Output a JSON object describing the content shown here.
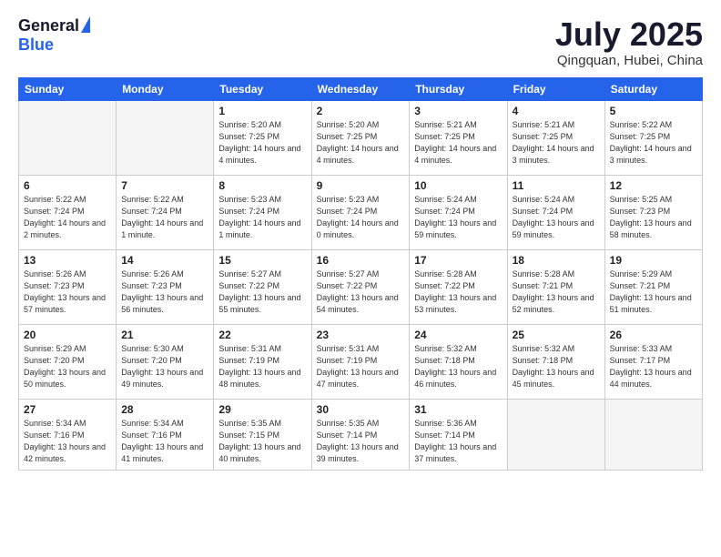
{
  "header": {
    "logo_general": "General",
    "logo_blue": "Blue",
    "month_title": "July 2025",
    "location": "Qingquan, Hubei, China"
  },
  "weekdays": [
    "Sunday",
    "Monday",
    "Tuesday",
    "Wednesday",
    "Thursday",
    "Friday",
    "Saturday"
  ],
  "weeks": [
    [
      {
        "day": "",
        "info": ""
      },
      {
        "day": "",
        "info": ""
      },
      {
        "day": "1",
        "info": "Sunrise: 5:20 AM\nSunset: 7:25 PM\nDaylight: 14 hours and 4 minutes."
      },
      {
        "day": "2",
        "info": "Sunrise: 5:20 AM\nSunset: 7:25 PM\nDaylight: 14 hours and 4 minutes."
      },
      {
        "day": "3",
        "info": "Sunrise: 5:21 AM\nSunset: 7:25 PM\nDaylight: 14 hours and 4 minutes."
      },
      {
        "day": "4",
        "info": "Sunrise: 5:21 AM\nSunset: 7:25 PM\nDaylight: 14 hours and 3 minutes."
      },
      {
        "day": "5",
        "info": "Sunrise: 5:22 AM\nSunset: 7:25 PM\nDaylight: 14 hours and 3 minutes."
      }
    ],
    [
      {
        "day": "6",
        "info": "Sunrise: 5:22 AM\nSunset: 7:24 PM\nDaylight: 14 hours and 2 minutes."
      },
      {
        "day": "7",
        "info": "Sunrise: 5:22 AM\nSunset: 7:24 PM\nDaylight: 14 hours and 1 minute."
      },
      {
        "day": "8",
        "info": "Sunrise: 5:23 AM\nSunset: 7:24 PM\nDaylight: 14 hours and 1 minute."
      },
      {
        "day": "9",
        "info": "Sunrise: 5:23 AM\nSunset: 7:24 PM\nDaylight: 14 hours and 0 minutes."
      },
      {
        "day": "10",
        "info": "Sunrise: 5:24 AM\nSunset: 7:24 PM\nDaylight: 13 hours and 59 minutes."
      },
      {
        "day": "11",
        "info": "Sunrise: 5:24 AM\nSunset: 7:24 PM\nDaylight: 13 hours and 59 minutes."
      },
      {
        "day": "12",
        "info": "Sunrise: 5:25 AM\nSunset: 7:23 PM\nDaylight: 13 hours and 58 minutes."
      }
    ],
    [
      {
        "day": "13",
        "info": "Sunrise: 5:26 AM\nSunset: 7:23 PM\nDaylight: 13 hours and 57 minutes."
      },
      {
        "day": "14",
        "info": "Sunrise: 5:26 AM\nSunset: 7:23 PM\nDaylight: 13 hours and 56 minutes."
      },
      {
        "day": "15",
        "info": "Sunrise: 5:27 AM\nSunset: 7:22 PM\nDaylight: 13 hours and 55 minutes."
      },
      {
        "day": "16",
        "info": "Sunrise: 5:27 AM\nSunset: 7:22 PM\nDaylight: 13 hours and 54 minutes."
      },
      {
        "day": "17",
        "info": "Sunrise: 5:28 AM\nSunset: 7:22 PM\nDaylight: 13 hours and 53 minutes."
      },
      {
        "day": "18",
        "info": "Sunrise: 5:28 AM\nSunset: 7:21 PM\nDaylight: 13 hours and 52 minutes."
      },
      {
        "day": "19",
        "info": "Sunrise: 5:29 AM\nSunset: 7:21 PM\nDaylight: 13 hours and 51 minutes."
      }
    ],
    [
      {
        "day": "20",
        "info": "Sunrise: 5:29 AM\nSunset: 7:20 PM\nDaylight: 13 hours and 50 minutes."
      },
      {
        "day": "21",
        "info": "Sunrise: 5:30 AM\nSunset: 7:20 PM\nDaylight: 13 hours and 49 minutes."
      },
      {
        "day": "22",
        "info": "Sunrise: 5:31 AM\nSunset: 7:19 PM\nDaylight: 13 hours and 48 minutes."
      },
      {
        "day": "23",
        "info": "Sunrise: 5:31 AM\nSunset: 7:19 PM\nDaylight: 13 hours and 47 minutes."
      },
      {
        "day": "24",
        "info": "Sunrise: 5:32 AM\nSunset: 7:18 PM\nDaylight: 13 hours and 46 minutes."
      },
      {
        "day": "25",
        "info": "Sunrise: 5:32 AM\nSunset: 7:18 PM\nDaylight: 13 hours and 45 minutes."
      },
      {
        "day": "26",
        "info": "Sunrise: 5:33 AM\nSunset: 7:17 PM\nDaylight: 13 hours and 44 minutes."
      }
    ],
    [
      {
        "day": "27",
        "info": "Sunrise: 5:34 AM\nSunset: 7:16 PM\nDaylight: 13 hours and 42 minutes."
      },
      {
        "day": "28",
        "info": "Sunrise: 5:34 AM\nSunset: 7:16 PM\nDaylight: 13 hours and 41 minutes."
      },
      {
        "day": "29",
        "info": "Sunrise: 5:35 AM\nSunset: 7:15 PM\nDaylight: 13 hours and 40 minutes."
      },
      {
        "day": "30",
        "info": "Sunrise: 5:35 AM\nSunset: 7:14 PM\nDaylight: 13 hours and 39 minutes."
      },
      {
        "day": "31",
        "info": "Sunrise: 5:36 AM\nSunset: 7:14 PM\nDaylight: 13 hours and 37 minutes."
      },
      {
        "day": "",
        "info": ""
      },
      {
        "day": "",
        "info": ""
      }
    ]
  ]
}
